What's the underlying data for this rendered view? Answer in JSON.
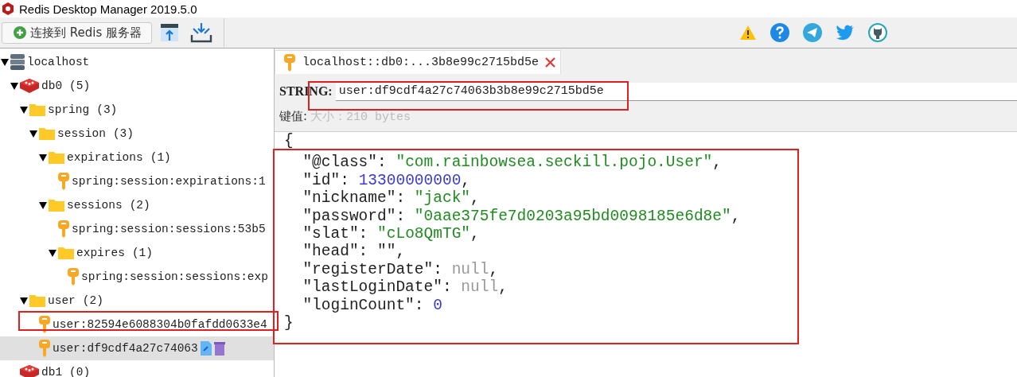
{
  "window": {
    "title": "Redis Desktop Manager 2019.5.0"
  },
  "toolbar": {
    "connect_button": {
      "label": "连接到 Redis 服务器"
    }
  },
  "tree": [
    {
      "kind": "server",
      "label": "localhost",
      "expanded": true,
      "selected": false,
      "children": [
        {
          "kind": "database",
          "label": "db0",
          "count": "(5)",
          "expanded": true,
          "selected": false,
          "children": [
            {
              "kind": "folder",
              "label": "spring",
              "count": "(3)",
              "expanded": true,
              "selected": false,
              "children": [
                {
                  "kind": "folder",
                  "label": "session",
                  "count": "(3)",
                  "expanded": true,
                  "selected": false,
                  "children": [
                    {
                      "kind": "folder",
                      "label": "expirations",
                      "count": "(1)",
                      "expanded": true,
                      "selected": false,
                      "children": [
                        {
                          "kind": "key",
                          "label": "spring:session:expirations:1",
                          "selected": false
                        }
                      ]
                    },
                    {
                      "kind": "folder",
                      "label": "sessions",
                      "count": "(2)",
                      "expanded": true,
                      "selected": false,
                      "children": [
                        {
                          "kind": "key",
                          "label": "spring:session:sessions:53b5",
                          "selected": false
                        },
                        {
                          "kind": "folder",
                          "label": "expires",
                          "count": "(1)",
                          "expanded": true,
                          "selected": false,
                          "children": [
                            {
                              "kind": "key",
                              "label": "spring:session:sessions:exp",
                              "selected": false
                            }
                          ]
                        }
                      ]
                    }
                  ]
                }
              ]
            },
            {
              "kind": "folder",
              "label": "user",
              "count": "(2)",
              "expanded": true,
              "selected": false,
              "children": [
                {
                  "kind": "key",
                  "label": "user:82594e6088304b0fafdd0633e4",
                  "selected": false
                },
                {
                  "kind": "key",
                  "label": "user:df9cdf4a27c74063",
                  "selected": true
                }
              ]
            }
          ]
        },
        {
          "kind": "database",
          "label": "db1",
          "count": "(0)",
          "selected": false
        }
      ]
    }
  ],
  "tabs": [
    {
      "label": "localhost::db0:...3b8e99c2715bd5e",
      "selected": true
    }
  ],
  "key": {
    "type": "STRING:",
    "name": "user:df9cdf4a27c74063b3b8e99c2715bd5e"
  },
  "value": {
    "label": "键值:",
    "size": "大小：210 bytes"
  },
  "editor": {
    "lines": [
      [
        {
          "text": "{",
          "kind": "punct"
        }
      ],
      [
        {
          "text": "  \"@class\": ",
          "kind": "punct"
        },
        {
          "text": "\"com.rainbowsea.seckill.pojo.User\"",
          "kind": "string"
        },
        {
          "text": ",",
          "kind": "punct"
        }
      ],
      [
        {
          "text": "  \"id\": ",
          "kind": "punct"
        },
        {
          "text": "13300000000",
          "kind": "number"
        },
        {
          "text": ",",
          "kind": "punct"
        }
      ],
      [
        {
          "text": "  \"nickname\": ",
          "kind": "punct"
        },
        {
          "text": "\"jack\"",
          "kind": "string"
        },
        {
          "text": ",",
          "kind": "punct"
        }
      ],
      [
        {
          "text": "  \"password\": ",
          "kind": "punct"
        },
        {
          "text": "\"0aae375fe7d0203a95bd0098185e6d8e\"",
          "kind": "string"
        },
        {
          "text": ",",
          "kind": "punct"
        }
      ],
      [
        {
          "text": "  \"slat\": ",
          "kind": "punct"
        },
        {
          "text": "\"cLo8QmTG\"",
          "kind": "string"
        },
        {
          "text": ",",
          "kind": "punct"
        }
      ],
      [
        {
          "text": "  \"head\": \"\",",
          "kind": "punct"
        }
      ],
      [
        {
          "text": "  \"registerDate\": ",
          "kind": "punct"
        },
        {
          "text": "null",
          "kind": "null"
        },
        {
          "text": ",",
          "kind": "punct"
        }
      ],
      [
        {
          "text": "  \"lastLoginDate\": ",
          "kind": "punct"
        },
        {
          "text": "null",
          "kind": "null"
        },
        {
          "text": ",",
          "kind": "punct"
        }
      ],
      [
        {
          "text": "  \"loginCount\": ",
          "kind": "punct"
        },
        {
          "text": "0",
          "kind": "number"
        }
      ],
      [
        {
          "text": "}",
          "kind": "punct"
        }
      ]
    ]
  }
}
